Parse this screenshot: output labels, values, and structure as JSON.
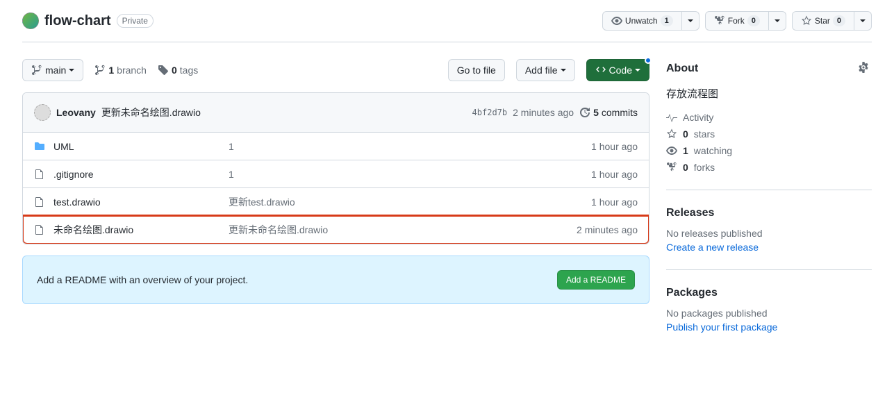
{
  "header": {
    "repo_name": "flow-chart",
    "visibility": "Private",
    "unwatch_label": "Unwatch",
    "unwatch_count": "1",
    "fork_label": "Fork",
    "fork_count": "0",
    "star_label": "Star",
    "star_count": "0"
  },
  "filenav": {
    "branch_name": "main",
    "branch_count": "1",
    "branch_text": "branch",
    "tag_count": "0",
    "tag_text": "tags",
    "goto_label": "Go to file",
    "addfile_label": "Add file",
    "code_label": "Code"
  },
  "commit_bar": {
    "author": "Leovany",
    "message": "更新未命名绘图.drawio",
    "sha": "4bf2d7b",
    "time": "2 minutes ago",
    "commit_count": "5",
    "commit_text": "commits"
  },
  "files": [
    {
      "type": "folder",
      "name": "UML",
      "msg": "1",
      "time": "1 hour ago"
    },
    {
      "type": "file",
      "name": ".gitignore",
      "msg": "1",
      "time": "1 hour ago"
    },
    {
      "type": "file",
      "name": "test.drawio",
      "msg": "更新test.drawio",
      "time": "1 hour ago"
    },
    {
      "type": "file",
      "name": "未命名绘图.drawio",
      "msg": "更新未命名绘图.drawio",
      "time": "2 minutes ago",
      "highlighted": true
    }
  ],
  "readme": {
    "prompt_text": "Add a README with an overview of your project.",
    "button_label": "Add a README"
  },
  "about": {
    "title": "About",
    "description": "存放流程图",
    "activity": "Activity",
    "stars_count": "0",
    "stars_text": "stars",
    "watching_count": "1",
    "watching_text": "watching",
    "forks_count": "0",
    "forks_text": "forks"
  },
  "releases": {
    "title": "Releases",
    "none_text": "No releases published",
    "create_link": "Create a new release"
  },
  "packages": {
    "title": "Packages",
    "none_text": "No packages published",
    "publish_link": "Publish your first package"
  }
}
